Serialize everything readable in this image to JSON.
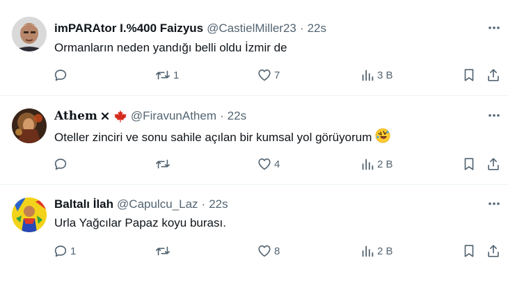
{
  "colors": {
    "text": "#0f1419",
    "secondary": "#536471",
    "divider": "#eff3f4"
  },
  "tweets": [
    {
      "name": "imPARAtor I.%400 Faizyus",
      "handle": "@CastielMiller23",
      "dot": "·",
      "time": "22s",
      "text": "Ormanların neden yandığı belli oldu İzmir de",
      "replies": "",
      "retweets": "1",
      "likes": "7",
      "views": "3 B"
    },
    {
      "name": "Athem",
      "name_badge_icon": "x-letter-icon",
      "flag_icon": "maple-leaf-icon",
      "handle": "@FiravunAthem",
      "dot": "·",
      "time": "22s",
      "text": "Oteller zinciri ve sonu sahile açılan bir kumsal yol görüyorum",
      "text_emoji_icon": "rolling-laughing-emoji-icon",
      "replies": "",
      "retweets": "",
      "likes": "4",
      "views": "2 B"
    },
    {
      "name": "Baltalı İlah",
      "handle": "@Capulcu_Laz",
      "dot": "·",
      "time": "22s",
      "text": "Urla Yağcılar Papaz koyu burası.",
      "replies": "1",
      "retweets": "",
      "likes": "8",
      "views": "2 B"
    }
  ],
  "more_label": "···"
}
